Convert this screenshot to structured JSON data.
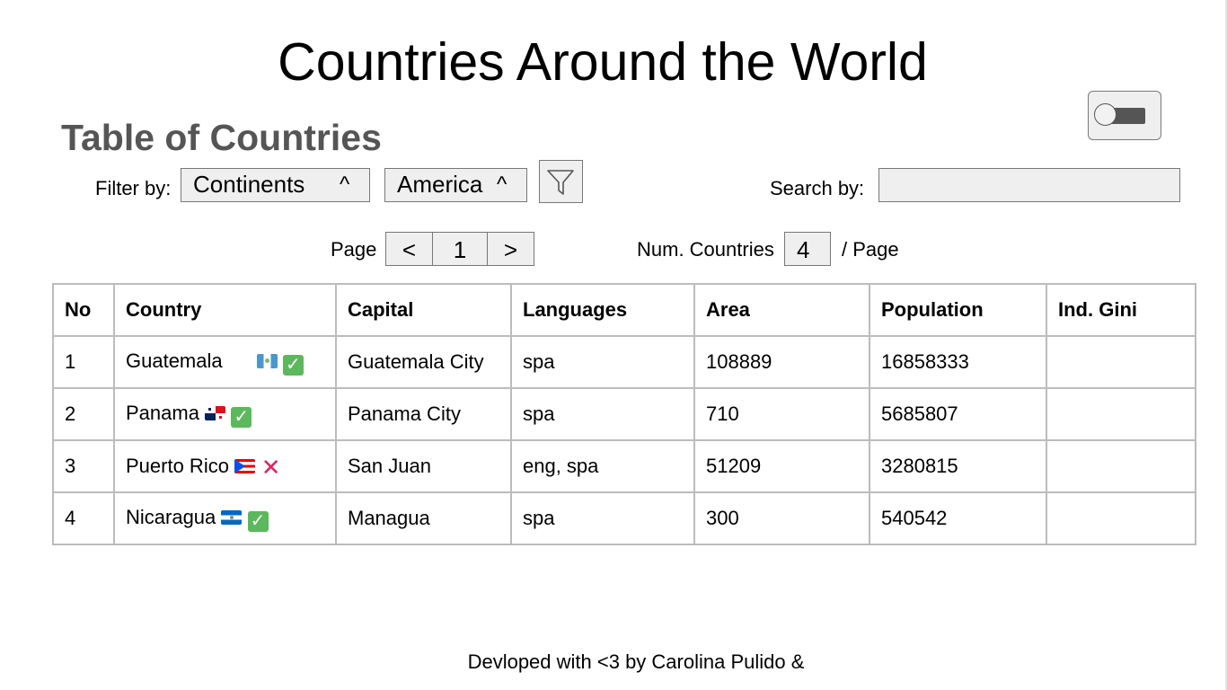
{
  "page": {
    "title": "Countries Around the World",
    "section_title": "Table of Countries",
    "footer": "Devloped with <3 by Carolina Pulido &"
  },
  "toggle": {
    "state": "off"
  },
  "filter": {
    "label": "Filter by:",
    "category_value": "Continents",
    "region_value": "America",
    "caret": "^",
    "filter_icon": "funnel-icon"
  },
  "search": {
    "label": "Search by:",
    "value": "",
    "placeholder": ""
  },
  "pagination": {
    "page_label": "Page",
    "prev_label": "<",
    "current_page": "1",
    "next_label": ">",
    "count_label": "Num. Countries",
    "count_value": "4",
    "per_page_label": "/ Page"
  },
  "table": {
    "headers": [
      "No",
      "Country",
      "Capital",
      "Languages",
      "Area",
      "Population",
      "Ind. Gini"
    ],
    "rows": [
      {
        "no": "1",
        "country": "Guatemala",
        "flag": "guatemala-flag-icon",
        "status": "check",
        "capital": "Guatemala City",
        "languages": "spa",
        "area": "108889",
        "population": "16858333",
        "gini": ""
      },
      {
        "no": "2",
        "country": "Panama",
        "flag": "panama-flag-icon",
        "status": "check",
        "capital": "Panama City",
        "languages": "spa",
        "area": "710",
        "population": "5685807",
        "gini": ""
      },
      {
        "no": "3",
        "country": "Puerto Rico",
        "flag": "puerto-rico-flag-icon",
        "status": "cross",
        "capital": "San Juan",
        "languages": "eng, spa",
        "area": "51209",
        "population": "3280815",
        "gini": ""
      },
      {
        "no": "4",
        "country": "Nicaragua",
        "flag": "nicaragua-flag-icon",
        "status": "check",
        "capital": "Managua",
        "languages": "spa",
        "area": "300",
        "population": "540542",
        "gini": ""
      }
    ]
  },
  "colors": {
    "section_title": "#555555",
    "check": "#5cb85c",
    "cross": "#e0245e",
    "control_bg": "#efefef",
    "table_border": "#bcbcbc"
  }
}
